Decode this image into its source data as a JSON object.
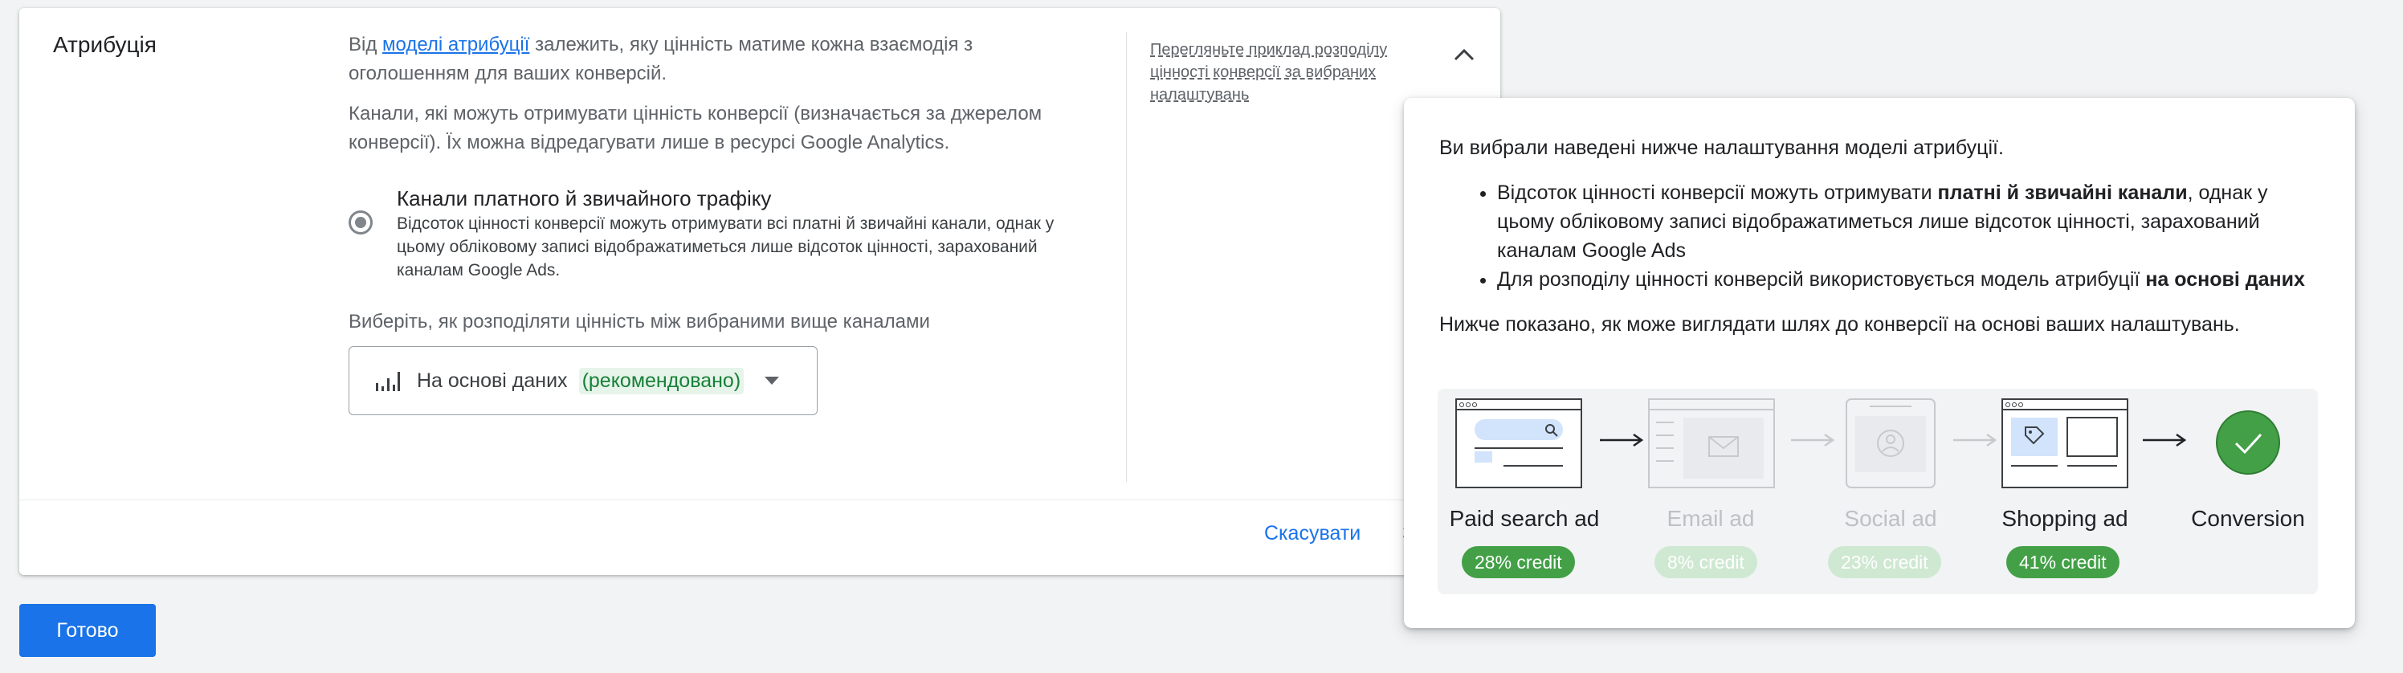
{
  "section": {
    "title": "Атрибуція",
    "para1_pre": "Від ",
    "para1_link": "моделі атрибуції",
    "para1_post": " залежить, яку цінність матиме кожна взаємодія з оголошенням для ваших конверсій.",
    "para2": "Канали, які можуть отримувати цінність конверсії (визначається за джерелом конверсії). Їх можна відредагувати лише в ресурсі Google Analytics.",
    "radio_title": "Канали платного й звичайного трафіку",
    "radio_desc": "Відсоток цінності конверсії можуть отримувати всі платні й звичайні канали, однак у цьому обліковому записі відображатиметься лише відсоток цінності, зарахований каналам Google Ads.",
    "choose_label": "Виберіть, як розподіляти цінність між вибраними вище каналами",
    "select_value": "На основі даних",
    "select_recommended": "(рекомендовано)",
    "example_link": "Перегляньте приклад розподілу цінності конверсії за вибраних налаштувань",
    "cancel_label": "Скасувати",
    "save_label": "Зб"
  },
  "done_label": "Готово",
  "popover": {
    "intro": "Ви вибрали наведені нижче налаштування моделі атрибуції.",
    "b1_pre": "Відсоток цінності конверсії можуть отримувати ",
    "b1_bold": "платні й звичайні канали",
    "b1_post": ", однак у цьому обліковому записі відображатиметься лише відсоток цінності, зарахований каналам Google Ads",
    "b2_pre": "Для розподілу цінності конверсій використовується модель атрибуції ",
    "b2_bold": "на основі даних",
    "path_label": "Нижче показано, як може виглядати шлях до конверсії на основі ваших налаштувань.",
    "steps": [
      {
        "label": "Paid search ad",
        "credit": "28% credit",
        "active": true
      },
      {
        "label": "Email ad",
        "credit": "8% credit",
        "active": false
      },
      {
        "label": "Social ad",
        "credit": "23% credit",
        "active": false
      },
      {
        "label": "Shopping ad",
        "credit": "41% credit",
        "active": true
      },
      {
        "label": "Conversion",
        "credit": "",
        "active": true
      }
    ]
  },
  "colors": {
    "accent": "#1a73e8",
    "credit_green": "#43a047",
    "credit_green_faded": "#cfe8d2"
  }
}
